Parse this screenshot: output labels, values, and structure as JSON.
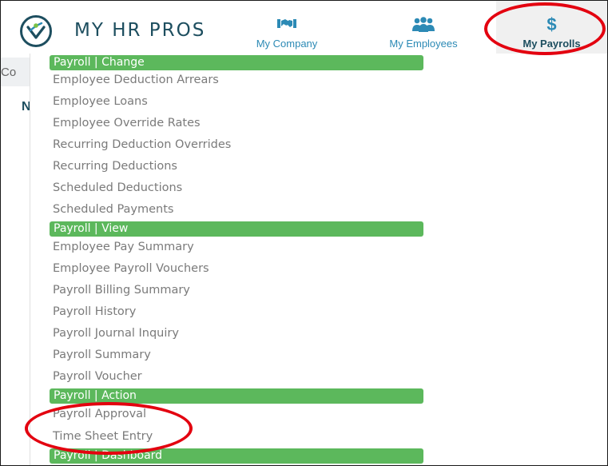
{
  "header": {
    "brand": "MY HR PROS",
    "nav": [
      {
        "label": "My Company",
        "icon": "handshake-icon"
      },
      {
        "label": "My Employees",
        "icon": "people-icon"
      },
      {
        "label": "My Payrolls",
        "icon": "dollar-icon",
        "symbol": "$",
        "active": true
      }
    ]
  },
  "background": {
    "fragment_1": "Co",
    "fragment_2": "N"
  },
  "menu": {
    "sections": [
      {
        "title": "Payroll | Change",
        "items": [
          "Employee Deduction Arrears",
          "Employee Loans",
          "Employee Override Rates",
          "Recurring Deduction Overrides",
          "Recurring Deductions",
          "Scheduled Deductions",
          "Scheduled Payments"
        ]
      },
      {
        "title": "Payroll | View",
        "items": [
          "Employee Pay Summary",
          "Employee Payroll Vouchers",
          "Payroll Billing Summary",
          "Payroll History",
          "Payroll Journal Inquiry",
          "Payroll Summary",
          "Payroll Voucher"
        ]
      },
      {
        "title": "Payroll | Action",
        "items": [
          "Payroll Approval",
          "Time Sheet Entry"
        ]
      },
      {
        "title": "Payroll | Dashboard",
        "items": []
      }
    ]
  },
  "colors": {
    "brand": "#1d4e5f",
    "nav_link": "#2c8ab5",
    "section_header": "#5cb85c",
    "menu_text": "#7a7a7a",
    "annotation": "#e3000f"
  }
}
